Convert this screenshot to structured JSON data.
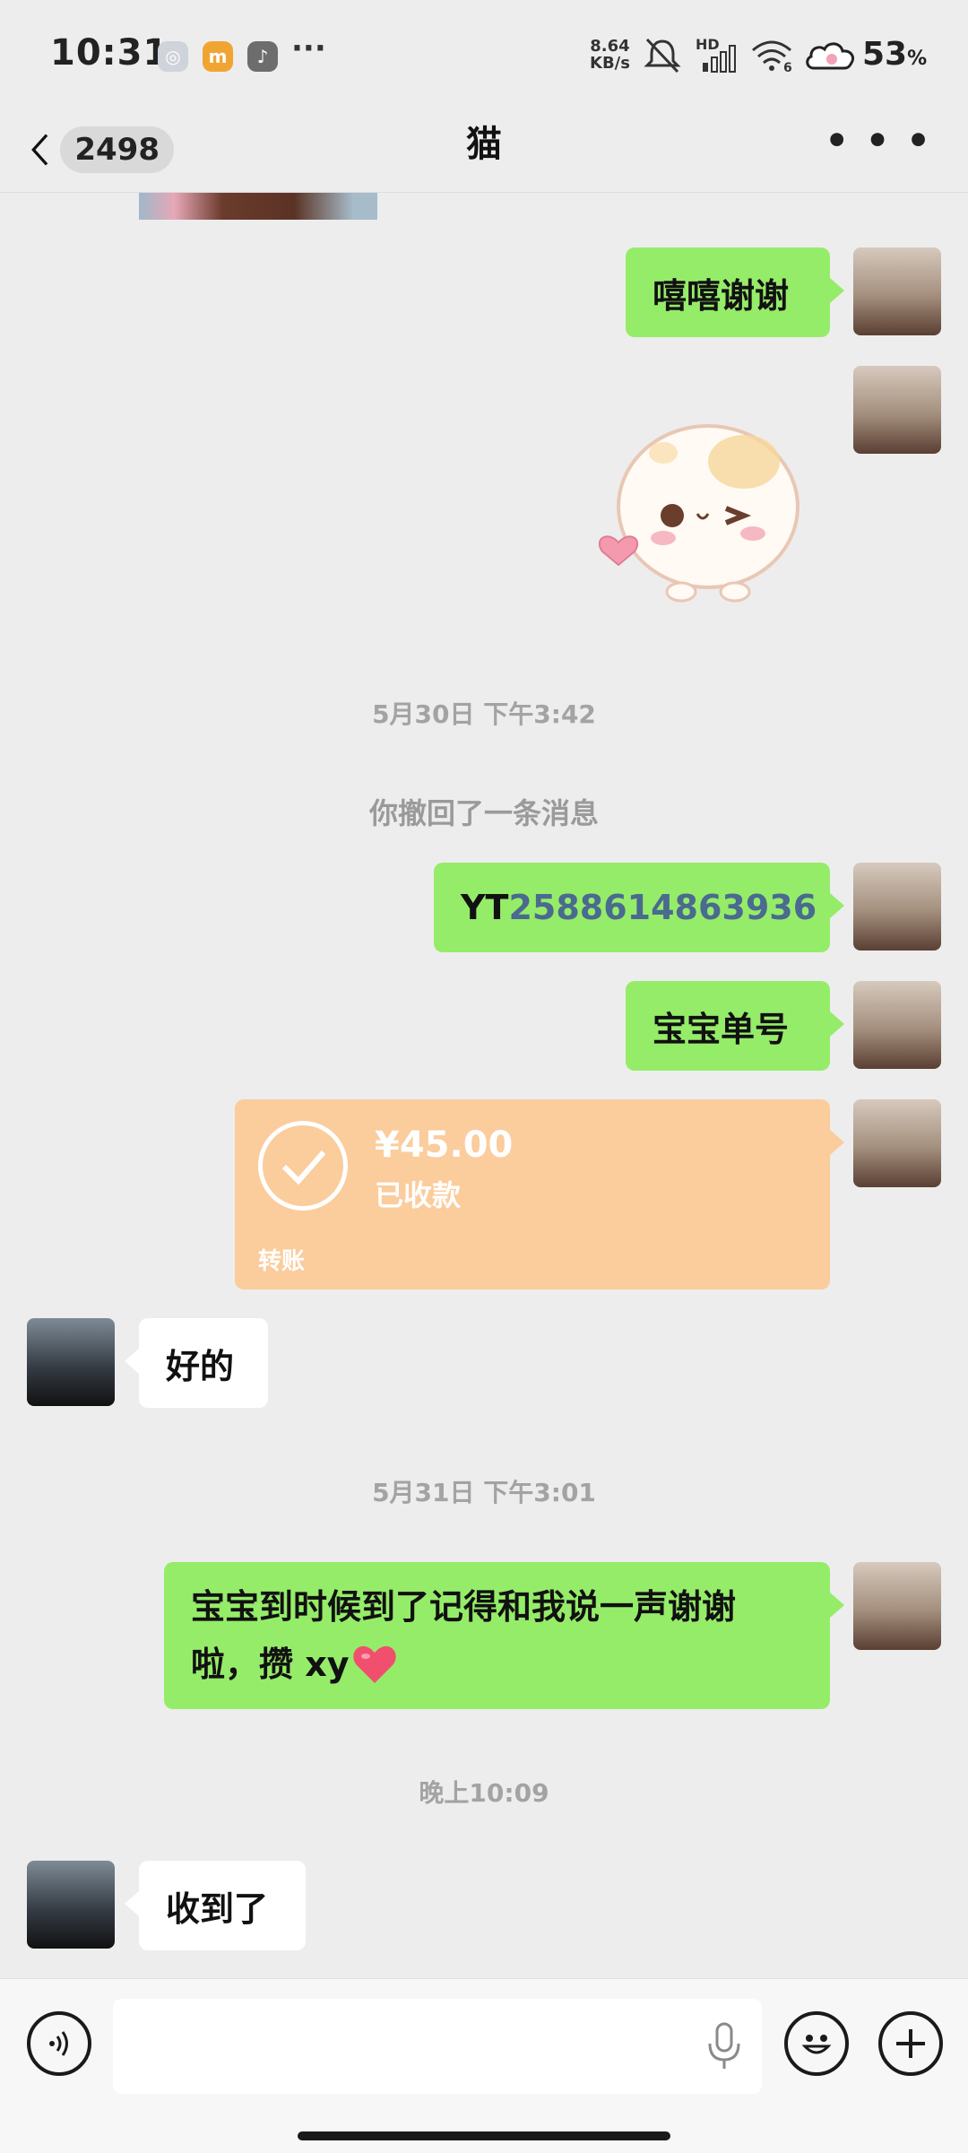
{
  "status_bar": {
    "time": "10:31",
    "net_speed_value": "8.64",
    "net_speed_unit": "KB/s",
    "hd_label": "HD",
    "wifi_label": "6",
    "battery": "53",
    "battery_unit": "%",
    "icons": [
      "weibo-icon",
      "mi-icon",
      "tiktok-icon",
      "more-dots-icon",
      "mute-icon",
      "signal-icon",
      "wifi-icon",
      "cloud-icon"
    ]
  },
  "header": {
    "unread_count": "2498",
    "title": "猫"
  },
  "messages": {
    "thanks": "嘻嘻谢谢",
    "timestamp1": "5月30日 下午3:42",
    "recall_note": "你撤回了一条消息",
    "tracking_prefix": "YT",
    "tracking_number": "2588614863936",
    "order_label": "宝宝单号",
    "reply_ok": "好的",
    "timestamp2": "5月31日 下午3:01",
    "long_line1": "宝宝到时候到了记得和我说一声谢谢",
    "long_line2": "啦，攒 xy",
    "timestamp3": "晚上10:09",
    "reply_received": "收到了"
  },
  "transfer": {
    "amount": "¥45.00",
    "status": "已收款",
    "label": "转账"
  },
  "colors": {
    "bubble_me": "#95ec69",
    "bubble_other": "#ffffff",
    "transfer_bg": "#fbcc9c",
    "chat_bg": "#ededed"
  }
}
